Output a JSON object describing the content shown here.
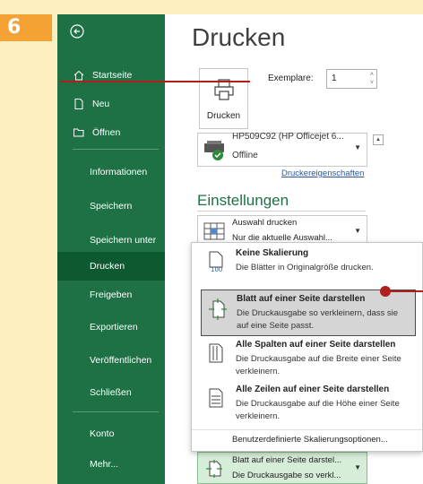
{
  "step": "6",
  "sidebar": {
    "items": [
      {
        "label": "Startseite",
        "icon": "home-icon"
      },
      {
        "label": "Neu",
        "icon": "new-document-icon"
      },
      {
        "label": "Öffnen",
        "icon": "open-folder-icon"
      },
      {
        "label": "Informationen"
      },
      {
        "label": "Speichern"
      },
      {
        "label": "Speichern unter"
      },
      {
        "label": "Drucken",
        "active": true
      },
      {
        "label": "Freigeben"
      },
      {
        "label": "Exportieren"
      },
      {
        "label": "Veröffentlichen"
      },
      {
        "label": "Schließen"
      },
      {
        "label": "Konto"
      },
      {
        "label": "Mehr..."
      }
    ]
  },
  "main": {
    "title": "Drucken",
    "print_button": "Drucken",
    "copies_label": "Exemplare:",
    "copies_value": "1",
    "printer": {
      "name": "HP509C92 (HP Officejet 6...",
      "status": "Offline"
    },
    "printer_props": "Druckereigenschaften",
    "settings_heading": "Einstellungen",
    "print_selection": {
      "line1": "Auswahl drucken",
      "line2": "Nur die aktuelle Auswahl..."
    },
    "scaling_select": {
      "line1": "Blatt auf einer Seite darstel...",
      "line2": "Die Druckausgabe so verkl..."
    }
  },
  "menu": {
    "options": [
      {
        "title": "Keine Skalierung",
        "desc": "Die Blätter in Originalgröße drucken.",
        "icon": "no-scaling-icon"
      },
      {
        "title": "Blatt auf einer Seite darstellen",
        "desc": "Die Druckausgabe so verkleinern, dass sie auf eine Seite passt.",
        "icon": "fit-sheet-icon",
        "highlighted": true
      },
      {
        "title": "Alle Spalten auf einer Seite darstellen",
        "desc": "Die Druckausgabe auf die Breite einer Seite verkleinern.",
        "icon": "fit-columns-icon"
      },
      {
        "title": "Alle Zeilen auf einer Seite darstellen",
        "desc": "Die Druckausgabe auf die Höhe einer Seite verkleinern.",
        "icon": "fit-rows-icon"
      }
    ],
    "custom": "Benutzerdefinierte Skalierungsoptionen..."
  },
  "colors": {
    "sidebar": "#1e7145",
    "active": "#0e5a30",
    "accent_orange": "#f3a233",
    "callout": "#b01e1e"
  }
}
